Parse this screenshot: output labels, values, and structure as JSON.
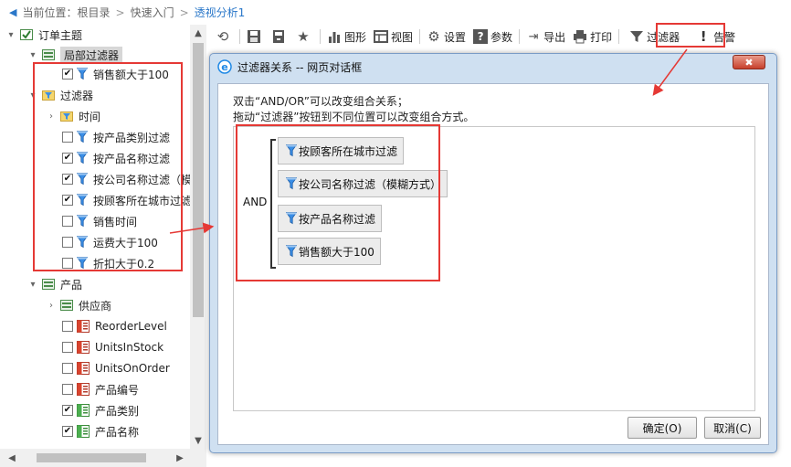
{
  "breadcrumb": {
    "prefix": "当前位置：",
    "items": [
      "根目录",
      "快速入门",
      "透视分析1"
    ],
    "separator": ">"
  },
  "tree": {
    "root": "订单主题",
    "local_filters": {
      "label": "局部过滤器",
      "items": [
        {
          "label": "销售额大于100",
          "checked": true
        }
      ]
    },
    "filters": {
      "label": "过滤器",
      "time_folder": "时间",
      "items": [
        {
          "label": "按产品类别过滤",
          "checked": false
        },
        {
          "label": "按产品名称过滤",
          "checked": true
        },
        {
          "label": "按公司名称过滤（模",
          "checked": true
        },
        {
          "label": "按顾客所在城市过滤",
          "checked": true
        },
        {
          "label": "销售时间",
          "checked": false
        },
        {
          "label": "运费大于100",
          "checked": false
        },
        {
          "label": "折扣大于0.2",
          "checked": false
        }
      ]
    },
    "product": {
      "label": "产品",
      "supplier": "供应商",
      "items": [
        {
          "label": "ReorderLevel",
          "checked": false
        },
        {
          "label": "UnitsInStock",
          "checked": false
        },
        {
          "label": "UnitsOnOrder",
          "checked": false
        },
        {
          "label": "产品编号",
          "checked": false
        },
        {
          "label": "产品类别",
          "checked": true
        },
        {
          "label": "产品名称",
          "checked": true
        }
      ]
    }
  },
  "toolbar": {
    "chart": "图形",
    "view": "视图",
    "settings": "设置",
    "params": "参数",
    "export": "导出",
    "print": "打印",
    "filter": "过滤器",
    "alert": "告警"
  },
  "dialog": {
    "title": "过滤器关系 -- 网页对话框",
    "close_label": "✖",
    "hint1": "双击“AND/OR”可以改变组合关系；",
    "hint2": "拖动“过滤器”按钮到不同位置可以改变组合方式。",
    "operator": "AND",
    "filters": [
      "按顾客所在城市过滤",
      "按公司名称过滤（模糊方式）",
      "按产品名称过滤",
      "销售额大于100"
    ],
    "ok": "确定(O)",
    "cancel": "取消(C)"
  },
  "colors": {
    "annotation_red": "#e53935",
    "link_blue": "#2a77c9",
    "dialog_frame": "#cfe0f1"
  }
}
